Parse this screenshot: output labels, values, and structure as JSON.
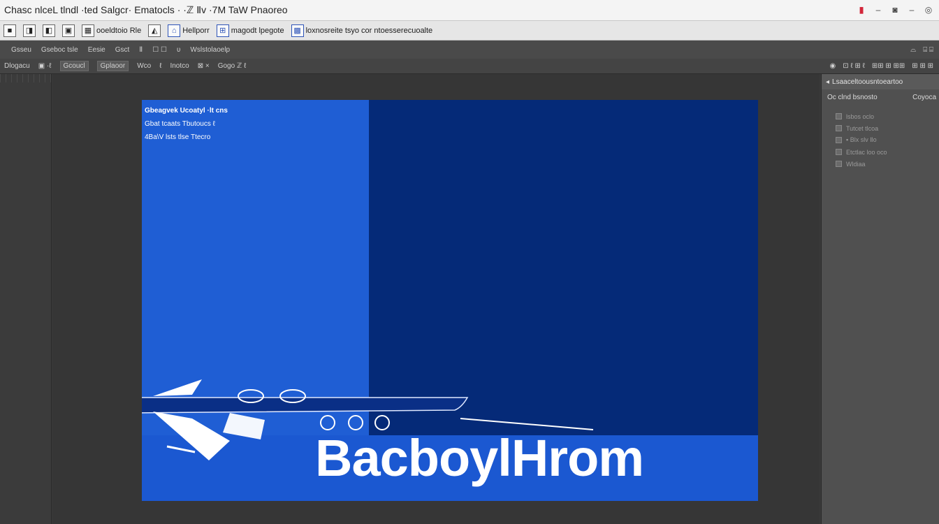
{
  "window": {
    "title": "Chasc nlceL tlndl ·ted Salgcr· Ematocls · ·ℤ Ⅱv ·7M TaW Pnaoreo"
  },
  "window_controls": [
    {
      "name": "record-icon",
      "glyph": "▮"
    },
    {
      "name": "dash-icon",
      "glyph": "–"
    },
    {
      "name": "camera-icon",
      "glyph": "◙"
    },
    {
      "name": "minimize-icon",
      "glyph": "–"
    },
    {
      "name": "settings-icon",
      "glyph": "◎"
    }
  ],
  "ribbon": {
    "items": [
      {
        "icon": "■",
        "label": ""
      },
      {
        "icon": "◨",
        "label": ""
      },
      {
        "icon": "◧",
        "label": ""
      },
      {
        "icon": "▣",
        "label": ""
      },
      {
        "icon": "▦",
        "label": "ooeldtoio Rle"
      },
      {
        "icon": "◭",
        "label": ""
      },
      {
        "icon": "⌂",
        "label": "Hellporr"
      },
      {
        "icon": "⊞",
        "label": "magodt lpegote"
      },
      {
        "icon": "▩",
        "label": "loxnosreite tsyo cor ntoesserecuoalte"
      }
    ]
  },
  "options_bar": {
    "items": [
      "Gsseu",
      "Gseboc   tsle",
      "Eesie",
      "Gsct",
      "Ⅱ",
      "☐ ☐",
      "ʋ",
      "Wslstolaoelp"
    ],
    "right": [
      "⌓",
      "⌸ ⌸"
    ]
  },
  "tool_bar": {
    "items": [
      "Dlogacu",
      "▣ ·ℓ",
      "Gcoucl",
      "Gplaoor",
      "Wco",
      "ℓ",
      "Inotco",
      "⊠ ×",
      "Gogo  ℤ ℓ"
    ],
    "right": [
      "◉",
      "⊡ ℓ ⊞ ℓ",
      "⊞⊞ ⊞ ⊞⊞",
      "⊞ ⊞ ⊞"
    ]
  },
  "canvas": {
    "lines": [
      "Gbeagvek Ucoatyl ·lt  cns",
      "Gbat  tcaats  Tbutoucs  ℓ",
      "4Ba\\V lsts tlse  Ttecro"
    ],
    "headline": "BacboylHrom",
    "colors": {
      "dark": "#052a78",
      "bright": "#1f5ed4",
      "band": "#1b58d1"
    }
  },
  "right_panel": {
    "header": "Lsaaceltoousntoeartoo",
    "row1_label": "Oc clnd bsnosto",
    "row1_value": "Coyoca",
    "layers": [
      "lsbos  oclo",
      "Tutcet tlcoa",
      "▪ Blx slv Ⅱo",
      "Etctlac loo  oco",
      "Wldiaa"
    ]
  }
}
